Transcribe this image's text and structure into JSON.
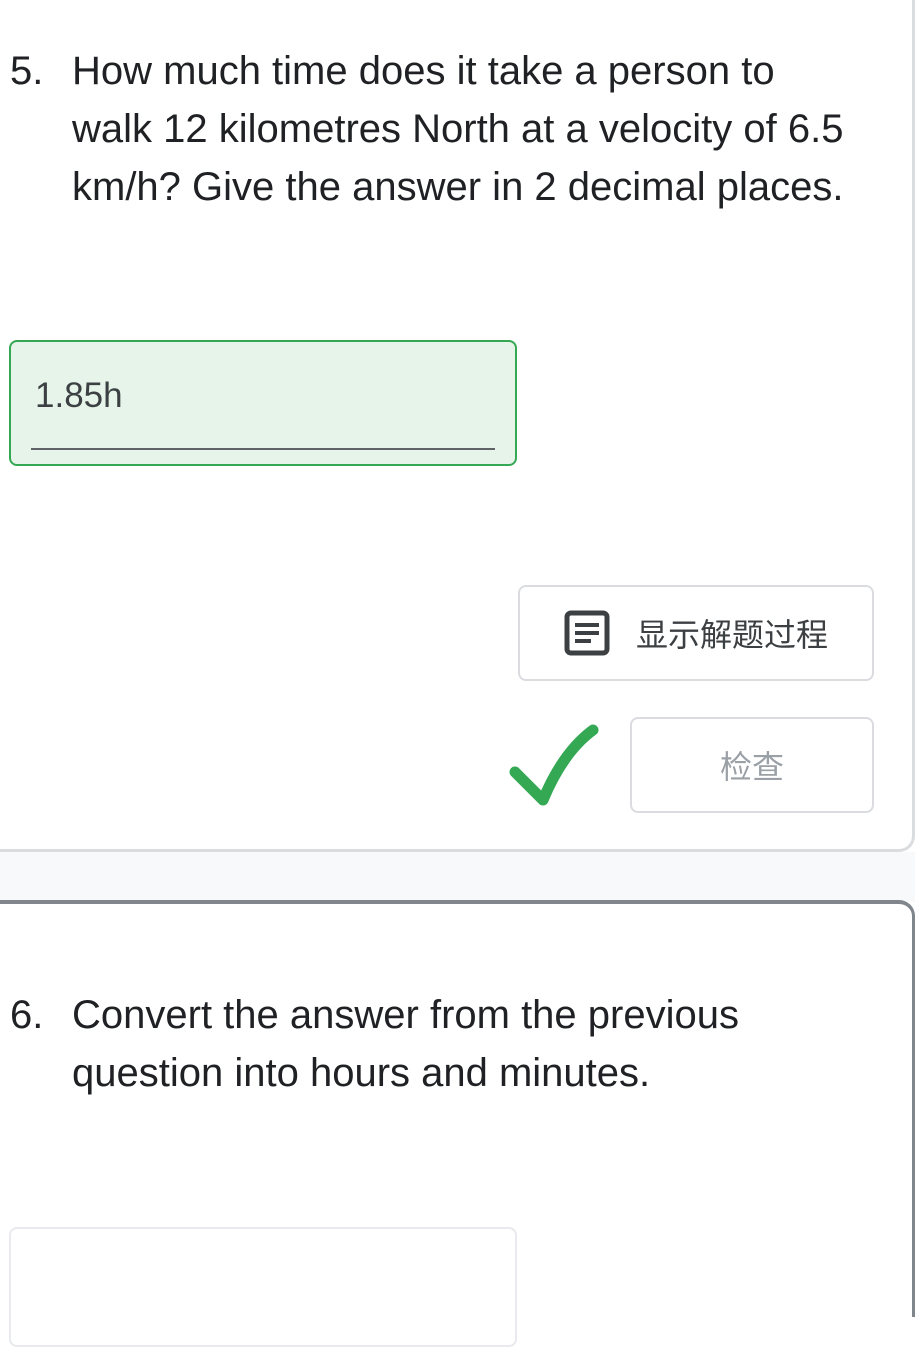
{
  "questions": [
    {
      "number": "5.",
      "text": "How much time does it take a person to walk 12 kilometres North at a velocity of 6.5 km/h? Give the answer in 2 decimal places.",
      "answer_value": "1.85h",
      "status": "correct"
    },
    {
      "number": "6.",
      "text": "Convert the answer from the previous question into hours and minutes.",
      "answer_value": ""
    }
  ],
  "buttons": {
    "show_solution_label": "显示解题过程",
    "check_label": "检查"
  },
  "icons": {
    "solution": "document-icon",
    "result": "checkmark-icon"
  },
  "colors": {
    "correct": "#34a853",
    "correct_bg": "#e6f4ea"
  }
}
